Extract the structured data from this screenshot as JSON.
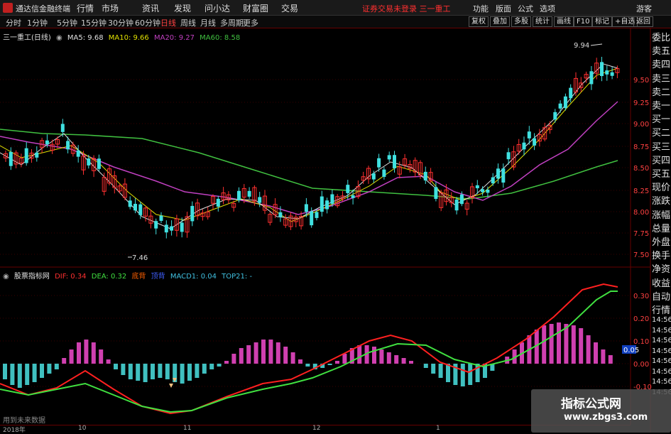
{
  "titlebar": {
    "app_name": "通达信金融终端",
    "menu": [
      "行情",
      "市场",
      "资讯",
      "发现",
      "问小达",
      "财富圈",
      "交易"
    ],
    "warning": "证券交易未登录  三一重工",
    "right_menu": [
      "功能",
      "版面",
      "公式",
      "选项"
    ],
    "guest": "游客"
  },
  "toolbar": {
    "periods": [
      "分时",
      "1分钟",
      "5分钟",
      "15分钟",
      "30分钟",
      "60分钟",
      "日线",
      "周线",
      "月线",
      "多周期",
      "更多"
    ],
    "active_period": "日线",
    "right_buttons": [
      "复权",
      "叠加",
      "多股",
      "统计",
      "画线",
      "F10",
      "标记",
      "+自选",
      "返回"
    ]
  },
  "price_chart": {
    "stock_title": "三一重工(日线)",
    "ma5": "MA5: 9.68",
    "ma10": "MA10: 9.66",
    "ma20": "MA20: 9.27",
    "ma60": "MA60: 8.58",
    "high_label": "9.94",
    "low_label": "7.46",
    "y_ticks": [
      "9.50",
      "9.25",
      "9.00",
      "8.75",
      "8.50",
      "8.25",
      "8.00",
      "7.75",
      "7.50"
    ]
  },
  "indicator_chart": {
    "name": "股票指标网",
    "dif": "DIF: 0.34",
    "dea": "DEA: 0.32",
    "signal_buy": "底背",
    "signal_sell": "顶背",
    "macd1": "MACD1: 0.04",
    "top21": "TOP21: -",
    "y_ticks": [
      "0.30",
      "0.20",
      "0.10",
      "0.00",
      "-0.10"
    ],
    "current_value": "0.05"
  },
  "side_panel": [
    "委比",
    "卖五",
    "卖四",
    "卖三",
    "卖二",
    "卖一",
    "买一",
    "买二",
    "买三",
    "买四",
    "买五",
    "现价",
    "涨跌",
    "涨幅",
    "总量",
    "外盘",
    "换手",
    "净资",
    "收益",
    "自动",
    "行情",
    "14:56",
    "14:56",
    "14:56",
    "14:56",
    "14:56",
    "14:56",
    "14:56",
    "14:56"
  ],
  "footer_note": "用到未来数据",
  "dates": [
    "2018年",
    "10",
    "11",
    "12",
    "1"
  ],
  "watermark": {
    "line1": "指标公式网",
    "line2": "www.zbgs3.com"
  },
  "colors": {
    "up": "#ff3030",
    "down": "#40e0e0",
    "ma5": "#e0e0e0",
    "ma10": "#e0e000",
    "ma20": "#c040c0",
    "ma60": "#40c040",
    "macd_pos": "#d040b0",
    "macd_neg": "#40c0c0",
    "dif": "#ff2020",
    "dea": "#40e040"
  }
}
